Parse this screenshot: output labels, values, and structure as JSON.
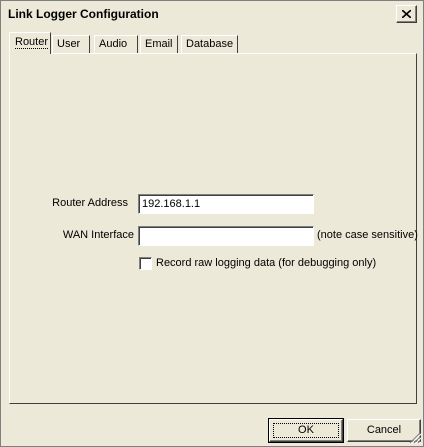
{
  "window": {
    "title": "Link Logger Configuration"
  },
  "tabs": [
    {
      "label": "Router",
      "active": true
    },
    {
      "label": "User",
      "active": false
    },
    {
      "label": "Audio",
      "active": false
    },
    {
      "label": "Email",
      "active": false
    },
    {
      "label": "Database",
      "active": false
    }
  ],
  "router": {
    "address_label": "Router Address",
    "address_value": "192.168.1.1",
    "wan_label": "WAN Interface",
    "wan_value": "",
    "wan_note": "(note case sensitive)",
    "raw_logging_label": "Record raw logging data (for debugging only)",
    "raw_logging_checked": false
  },
  "buttons": {
    "ok": "OK",
    "cancel": "Cancel"
  },
  "icons": {
    "close": "close-icon",
    "grip": "resize-grip-icon"
  }
}
